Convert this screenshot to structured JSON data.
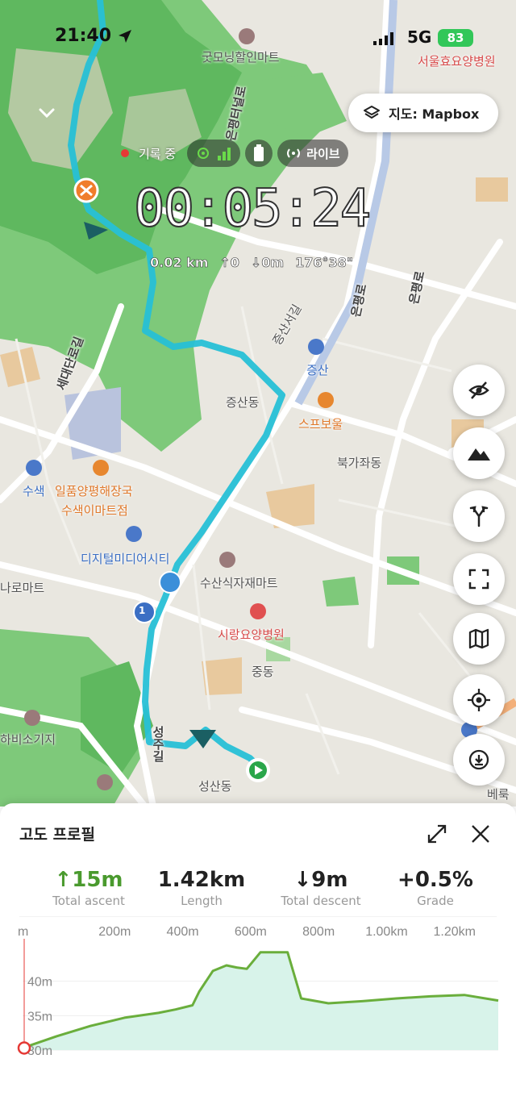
{
  "status_bar": {
    "time": "21:40",
    "network": "5G",
    "battery": "83"
  },
  "map": {
    "layer_button_label": "지도: Mapbox",
    "recording_label": "기록 중",
    "live_label": "라이브",
    "timer": "00:05:24",
    "distance": "0.02 km",
    "ascent": "↑0",
    "descent": "↓0m",
    "heading": "176°38\"",
    "labels": {
      "mart_top": "굿모닝할인마트",
      "hospital_top": "서울효요양병원",
      "road_vertical_1": "은평터널로",
      "road_left": "세대단로길",
      "road_right": "은평로",
      "jeungsan_seo": "증산서길",
      "jeungsan_station": "증산",
      "jeungsan_dong": "증산동",
      "restaurant": "스프보울",
      "bukgajwa": "북가좌동",
      "susaek": "수색",
      "restaurant2_line1": "일품양평해장국",
      "restaurant2_line2": "수색이마트점",
      "dmc": "디지털미디어시티",
      "market": "수산식자재마트",
      "naro": "나로마트",
      "hospital_mid": "시랑요양병원",
      "jungdong": "중동",
      "road_seongju": "성주길",
      "seongsan": "성산동",
      "badge_1": "1",
      "bottom_left": "하비소기지",
      "bottom_right": "베룩"
    }
  },
  "sheet": {
    "title": "고도 프로필",
    "metrics": [
      {
        "value": "↑15m",
        "label": "Total ascent"
      },
      {
        "value": "1.42km",
        "label": "Length"
      },
      {
        "value": "↓9m",
        "label": "Total descent"
      },
      {
        "value": "+0.5%",
        "label": "Grade"
      }
    ]
  },
  "chart_data": {
    "type": "area",
    "x_tick_labels": [
      "m",
      "200m",
      "400m",
      "600m",
      "800m",
      "1.00km",
      "1.20km"
    ],
    "y_tick_labels": [
      "40m",
      "35m",
      "30m"
    ],
    "x_unit": "m",
    "y_unit": "m",
    "ylim": [
      30,
      45
    ],
    "xlim": [
      0,
      1400
    ],
    "x": [
      0,
      100,
      200,
      300,
      400,
      450,
      500,
      520,
      560,
      600,
      630,
      660,
      700,
      750,
      780,
      820,
      900,
      1000,
      1100,
      1200,
      1300,
      1400
    ],
    "y": [
      30.3,
      32.0,
      33.5,
      34.7,
      35.4,
      35.9,
      36.5,
      38.5,
      41.5,
      42.3,
      42.0,
      41.8,
      44.2,
      44.2,
      44.2,
      37.5,
      36.8,
      37.1,
      37.5,
      37.8,
      38.0,
      37.2
    ],
    "colors": {
      "line": "#6aae3c",
      "fill": "#d8f3ea"
    }
  }
}
